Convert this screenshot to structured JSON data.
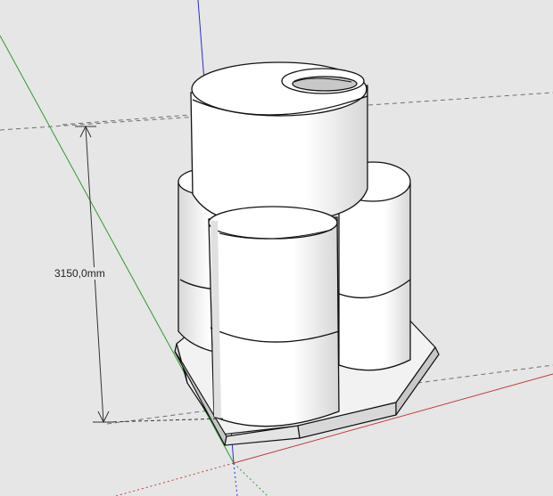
{
  "viewport": {
    "background_color": "#e6e6e6",
    "model": "stacked-cylinders-on-octagonal-base"
  },
  "dimension": {
    "label": "3150,0mm"
  },
  "axes": {
    "red_color": "#c43a3a",
    "green_color": "#2f9a2f",
    "blue_color": "#2b2bd6",
    "guide_color": "#6f6f6f"
  },
  "colors": {
    "surface_light": "#ffffff",
    "surface_shade": "#c9c9c9",
    "edge": "#111111"
  }
}
